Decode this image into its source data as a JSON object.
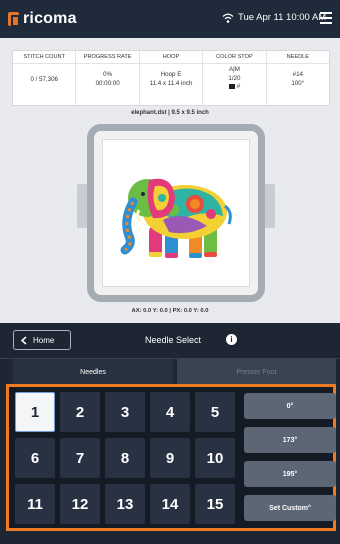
{
  "header": {
    "brand": "ricoma",
    "datetime": "Tue Apr 11  10:00 AM",
    "icons": {
      "wifi": "wifi-icon",
      "menu": "hamburger-menu-icon"
    }
  },
  "stats": {
    "stitch_count": {
      "label": "STITCH COUNT",
      "value": "0 / 57,306"
    },
    "progress_rate": {
      "label": "PROGRESS RATE",
      "percent": "0%",
      "time": "00:00:00"
    },
    "hoop": {
      "label": "HOOP",
      "name": "Hoop E",
      "size": "11.4 x 11.4 inch"
    },
    "color_stop": {
      "label": "COLOR STOP",
      "line1": "A|M",
      "line2": "1/20",
      "line3": "#"
    },
    "needle": {
      "label": "NEEDLE",
      "number": "#14",
      "angle": "100°"
    }
  },
  "design": {
    "info": "elephant.dst  |  9.5 x 9.5 inch"
  },
  "coords": "AX: 0.0  Y: 0.0  |  PX: 0.0  Y: 0.0",
  "panel": {
    "home_label": "Home",
    "title": "Needle Select",
    "tabs": {
      "needles": "Needles",
      "presser_foot": "Presser Foot"
    },
    "needles": [
      "1",
      "2",
      "3",
      "4",
      "5",
      "6",
      "7",
      "8",
      "9",
      "10",
      "11",
      "12",
      "13",
      "14",
      "15"
    ],
    "selected_needle": "1",
    "angles": [
      "0°",
      "173°",
      "195°",
      "Set Custom°"
    ]
  },
  "colors": {
    "accent": "#f07a21",
    "header_bg": "#1f2a3a",
    "panel_bg": "#1e2633"
  }
}
